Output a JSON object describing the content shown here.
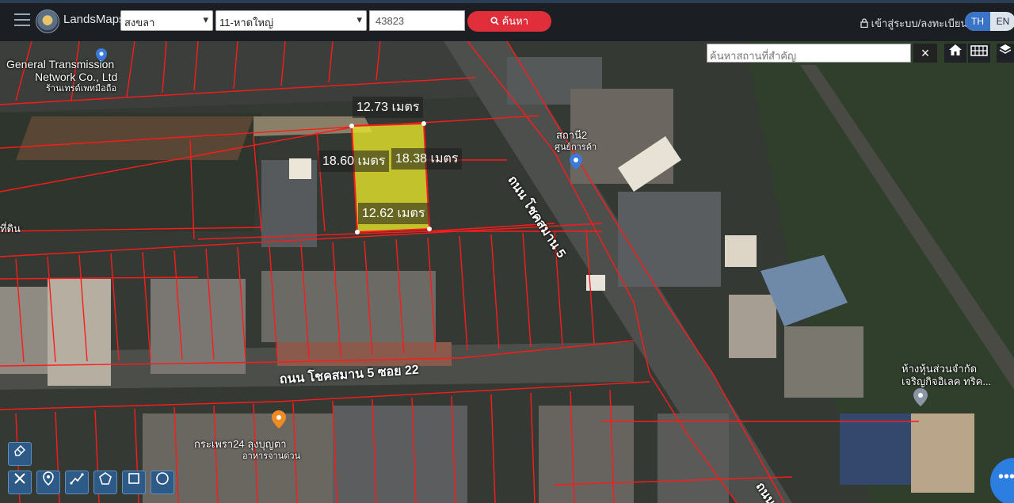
{
  "header": {
    "brand": "LandsMaps",
    "province": "สงขลา",
    "district": "11-หาดใหญ่",
    "parcel_no": "43823",
    "search_label": "ค้นหา",
    "login_label": "เข้าสู่ระบบ/ลงทะเบียน",
    "lang_th": "TH",
    "lang_en": "EN"
  },
  "map_search": {
    "placeholder": "ค้นหาสถานที่สำคัญ",
    "close": "×"
  },
  "places": {
    "company_line1": "General Transmission",
    "company_line2": "Network Co., Ltd",
    "shop_small": "ร้านเทรด์เพทมือถือ",
    "station_line1": "สถานี2",
    "station_line2": "ศูนย์การค้า",
    "left_edge": "ที่ดิน",
    "partnership_line1": "ห้างหุ้นส่วนจำกัด",
    "partnership_line2": "เจริญกิจอิเลค ทริค...",
    "restaurant_line1": "กระเพรา24 ลุงบุญตา",
    "restaurant_line2": "อาหารจานด่วน"
  },
  "roads": {
    "main": "ถนน โชคสมาน 5",
    "soi": "ถนน โชคสมาน 5 ซอย 22",
    "corner": "ถนน"
  },
  "dimensions": {
    "top": "12.73 เมตร",
    "left": "18.60 เมตร",
    "right": "18.38 เมตร",
    "bottom": "12.62 เมตร"
  },
  "colors": {
    "parcel_fill": "#e5e52b",
    "parcel_line": "#ff1a1a",
    "accent": "#e02f3b",
    "lang_active": "#3b74c6"
  }
}
